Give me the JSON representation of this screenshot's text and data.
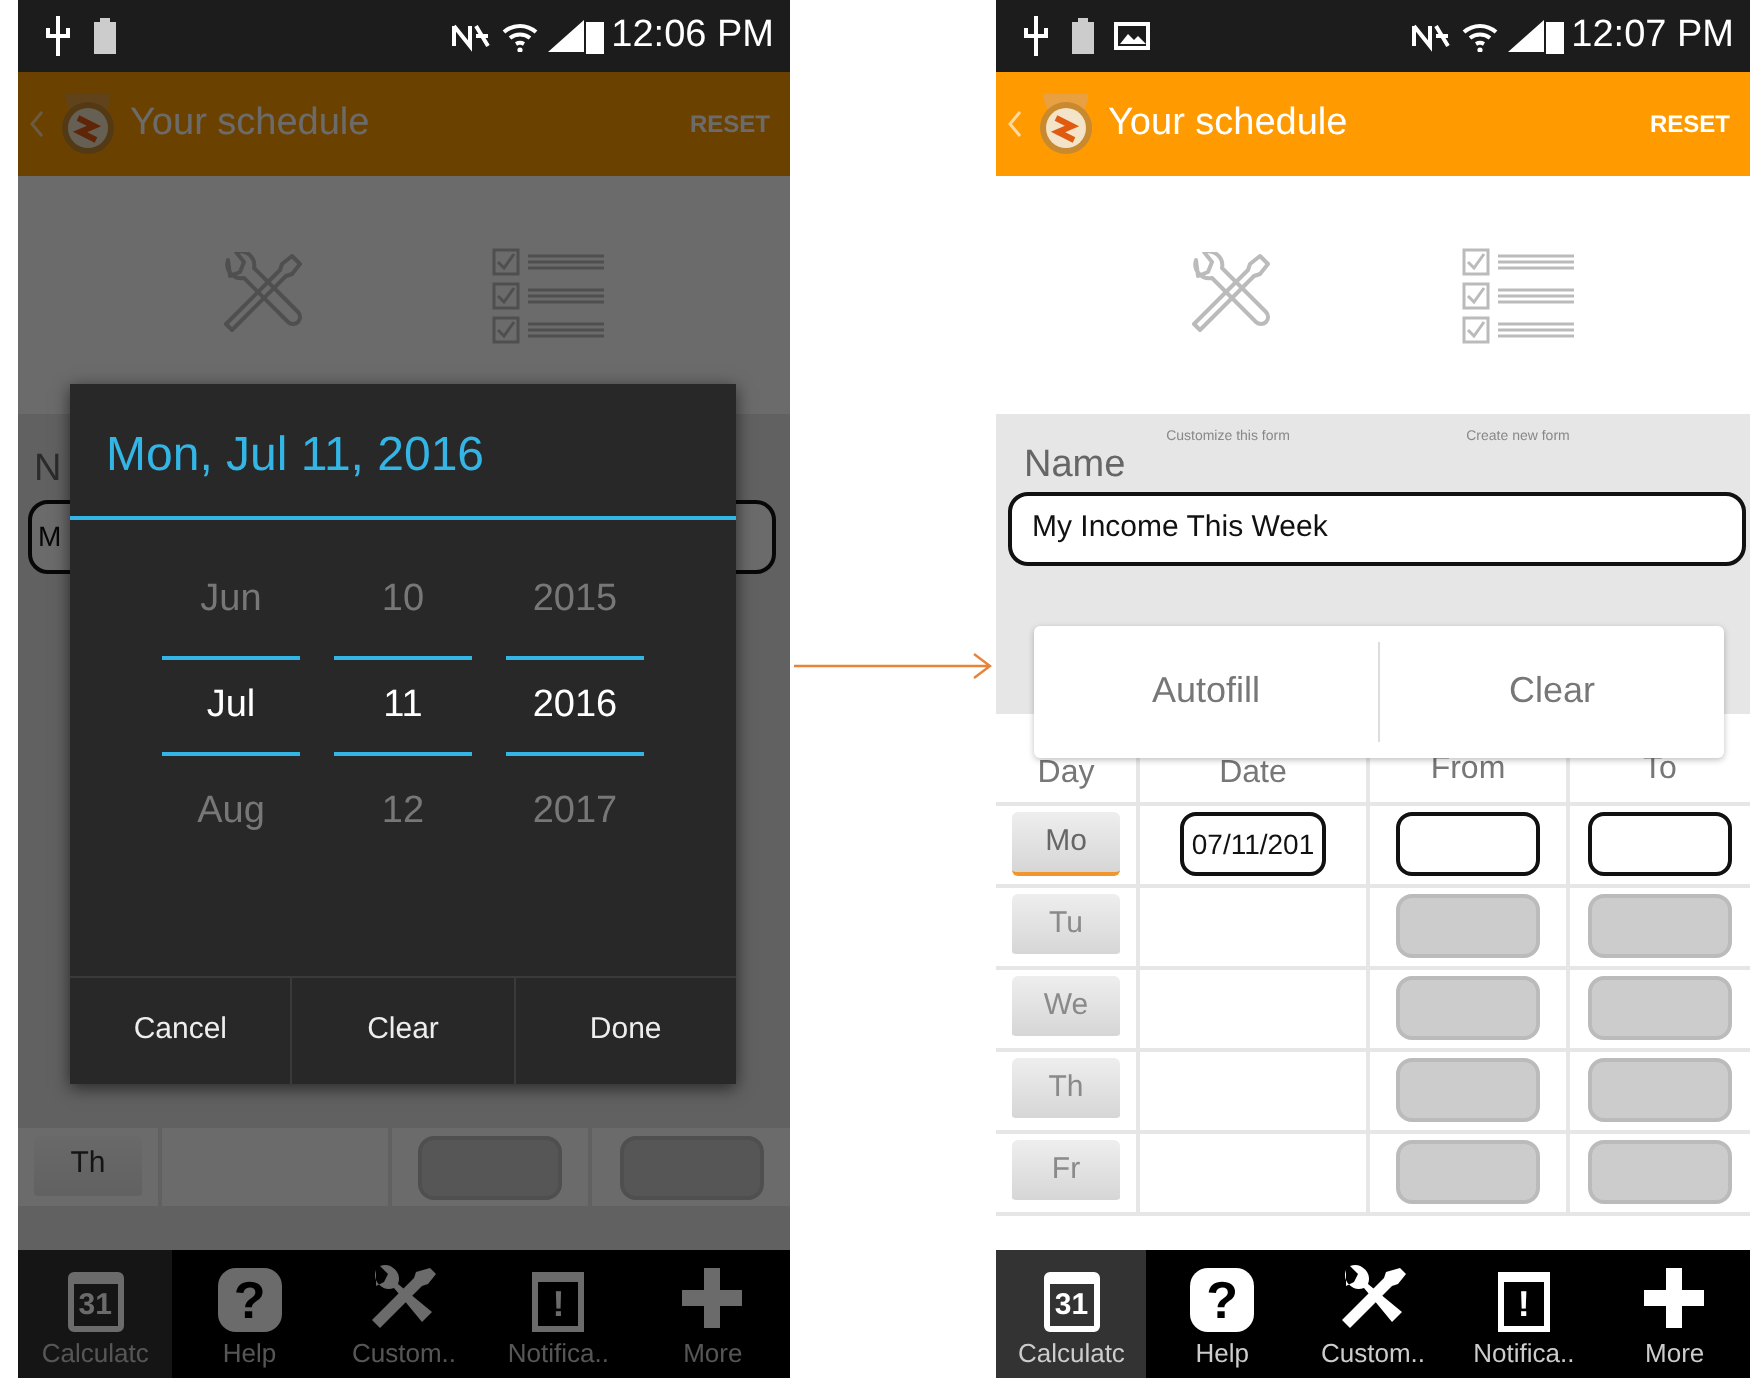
{
  "before_screen": {
    "dimmed": true,
    "status_bar": {
      "time": "12:06 PM"
    },
    "app_bar": {
      "title": "Your schedule",
      "action": "RESET"
    },
    "name_label_fragment": "N",
    "name_value_fragment": "M",
    "background_rows": [
      {
        "day": "Th"
      }
    ],
    "date_dialog": {
      "title": "Mon, Jul 11, 2016",
      "columns": [
        {
          "above": "Jun",
          "current": "Jul",
          "below": "Aug"
        },
        {
          "above": "10",
          "current": "11",
          "below": "12"
        },
        {
          "above": "2015",
          "current": "2016",
          "below": "2017"
        }
      ],
      "buttons": [
        "Cancel",
        "Clear",
        "Done"
      ]
    },
    "bottom_nav": [
      {
        "kind": "calendar",
        "icon_text": "31",
        "label": "Calculatc",
        "selected": true
      },
      {
        "kind": "help",
        "icon_text": "?",
        "label": "Help",
        "selected": false
      },
      {
        "kind": "tools",
        "label": "Custom..",
        "selected": false
      },
      {
        "kind": "alert",
        "icon_text": "!",
        "label": "Notifica..",
        "selected": false
      },
      {
        "kind": "add",
        "label": "More",
        "selected": false
      }
    ]
  },
  "after_screen": {
    "dimmed": false,
    "status_bar": {
      "time": "12:07 PM"
    },
    "app_bar": {
      "title": "Your schedule",
      "action": "RESET"
    },
    "form_captions": [
      "Customize this form",
      "Create new form"
    ],
    "name_label": "Name",
    "name_value": "My Income This Week",
    "actions": [
      "Autofill",
      "Clear"
    ],
    "table": {
      "columns": [
        "Day",
        "Date",
        "From",
        "To"
      ],
      "rows": [
        {
          "day": "Mo",
          "selected": true,
          "disabled": false,
          "date": "07/11/201"
        },
        {
          "day": "Tu",
          "selected": false,
          "disabled": true
        },
        {
          "day": "We",
          "selected": false,
          "disabled": true
        },
        {
          "day": "Th",
          "selected": false,
          "disabled": true
        },
        {
          "day": "Fr",
          "selected": false,
          "disabled": true
        }
      ]
    },
    "bottom_nav": [
      {
        "kind": "calendar",
        "icon_text": "31",
        "label": "Calculatc",
        "selected": true
      },
      {
        "kind": "help",
        "icon_text": "?",
        "label": "Help",
        "selected": false
      },
      {
        "kind": "tools",
        "label": "Custom..",
        "selected": false
      },
      {
        "kind": "alert",
        "icon_text": "!",
        "label": "Notifica..",
        "selected": false
      },
      {
        "kind": "add",
        "label": "More",
        "selected": false
      }
    ]
  }
}
